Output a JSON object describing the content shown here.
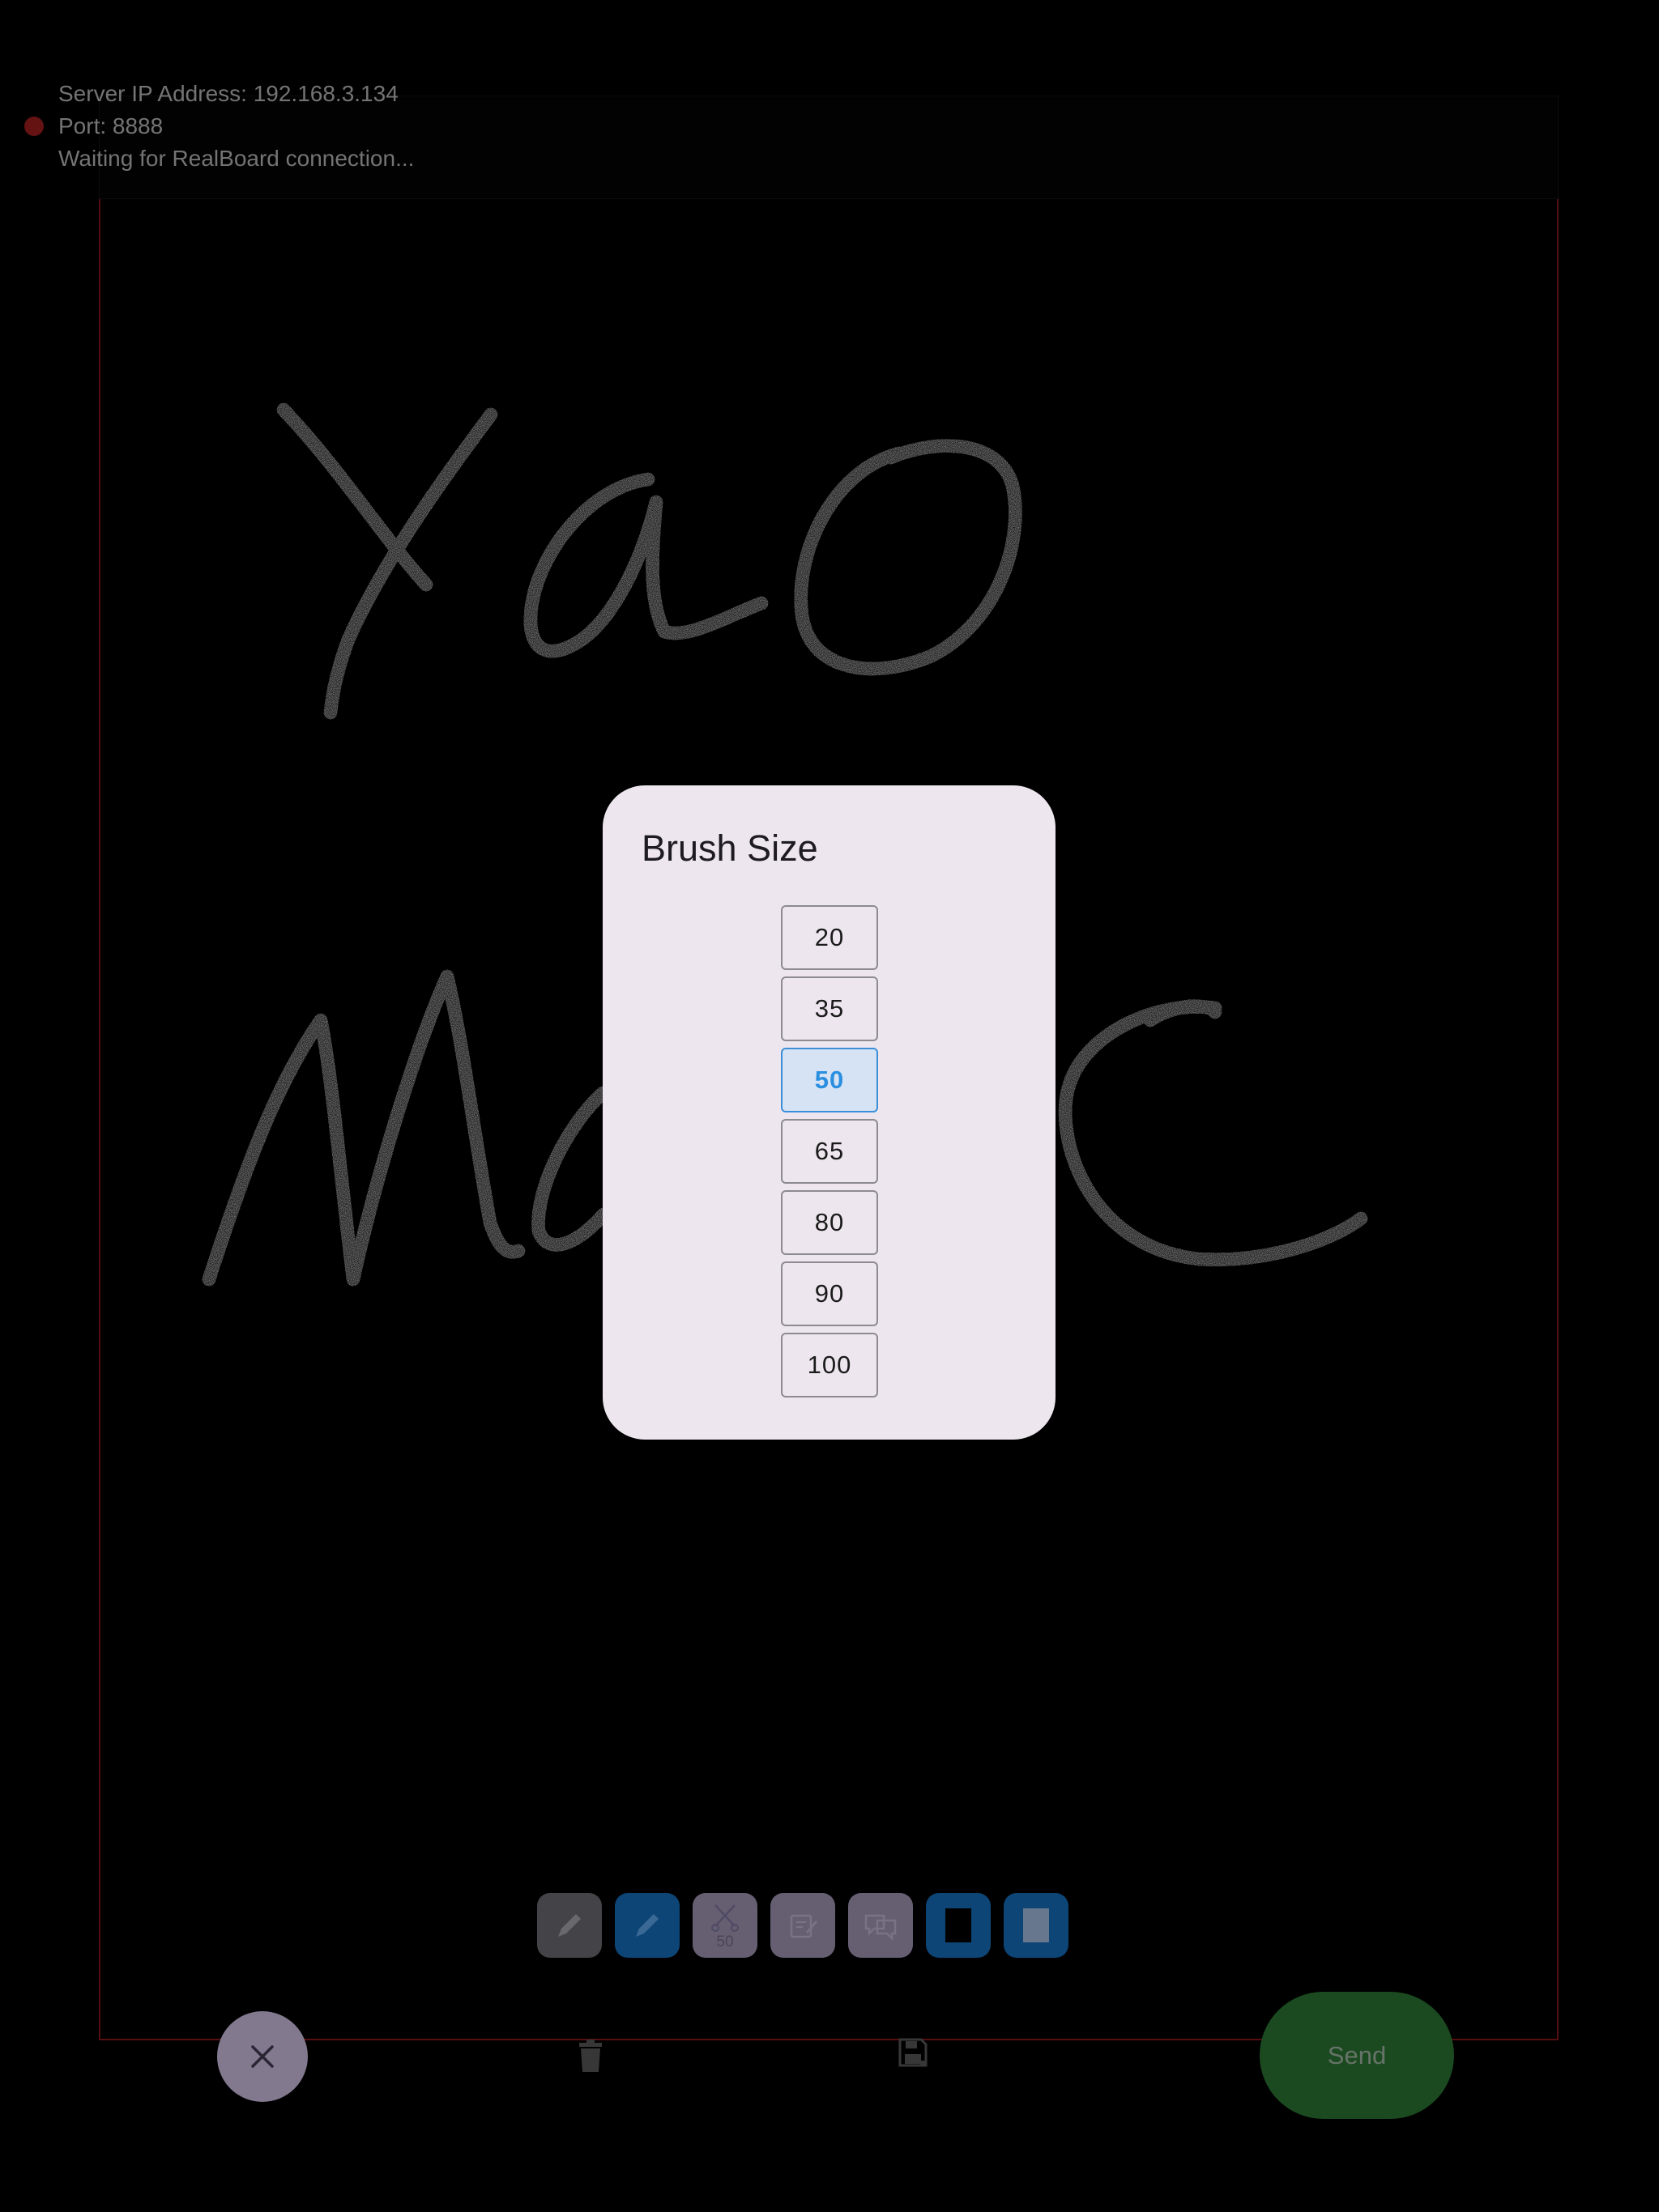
{
  "status": {
    "server_ip": "Server IP Address: 192.168.3.134",
    "port": "Port: 8888",
    "connection": "Waiting for RealBoard connection..."
  },
  "dialog": {
    "title": "Brush Size",
    "options": [
      "20",
      "35",
      "50",
      "65",
      "80",
      "90",
      "100"
    ],
    "selected": "50"
  },
  "toolbar": {
    "brush_size_badge": "50",
    "tools": [
      {
        "name": "pencil-tool",
        "icon": "pencil-icon",
        "color": "#48474b"
      },
      {
        "name": "pen-tool",
        "icon": "pencil-icon",
        "color": "#0e497d"
      },
      {
        "name": "brush-size-tool",
        "icon": "scissors-icon",
        "color": "#6c6579"
      },
      {
        "name": "note-tool",
        "icon": "edit-note-icon",
        "color": "#6c6579"
      },
      {
        "name": "comment-tool",
        "icon": "comments-icon",
        "color": "#6c6579"
      },
      {
        "name": "black-background-tool",
        "icon": "black-page-icon",
        "color": "#0e497d"
      },
      {
        "name": "white-background-tool",
        "icon": "white-page-icon",
        "color": "#0e497d"
      }
    ]
  },
  "actions": {
    "close_icon": "close-icon",
    "delete_icon": "trash-icon",
    "save_icon": "save-icon",
    "send_label": "Send"
  },
  "colors": {
    "background": "#000000",
    "canvas_border": "#5b0f12",
    "status_indicator": "#6a1414",
    "dialog_background": "#ede6ee",
    "selected_accent": "#2b8fe0",
    "send_button": "#1d4f22"
  }
}
